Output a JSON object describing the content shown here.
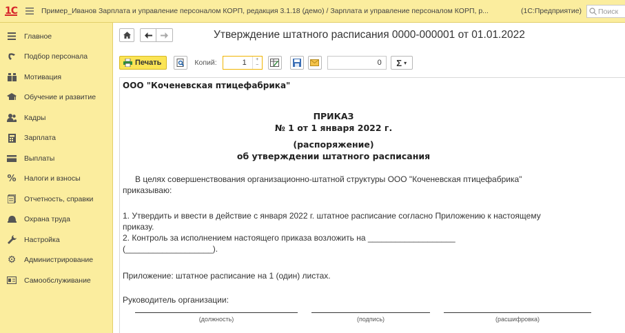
{
  "titlebar": {
    "logo": "1С",
    "title": "Пример_Иванов Зарплата и управление персоналом КОРП, редакция 3.1.18 (демо) / Зарплата и управление персоналом КОРП, р...",
    "app": "(1С:Предприятие)",
    "search_placeholder": "Поиск"
  },
  "sidebar": {
    "items": [
      {
        "label": "Главное",
        "icon": "menu-lines-icon"
      },
      {
        "label": "Подбор персонала",
        "icon": "recruit-icon"
      },
      {
        "label": "Мотивация",
        "icon": "people-icon"
      },
      {
        "label": "Обучение и развитие",
        "icon": "graduation-cap-icon"
      },
      {
        "label": "Кадры",
        "icon": "staff-icon"
      },
      {
        "label": "Зарплата",
        "icon": "calculator-icon"
      },
      {
        "label": "Выплаты",
        "icon": "payment-icon"
      },
      {
        "label": "Налоги и взносы",
        "icon": "percent-icon"
      },
      {
        "label": "Отчетность, справки",
        "icon": "report-icon"
      },
      {
        "label": "Охрана труда",
        "icon": "helmet-icon"
      },
      {
        "label": "Настройка",
        "icon": "wrench-icon"
      },
      {
        "label": "Администрирование",
        "icon": "gear-icon"
      },
      {
        "label": "Самообслуживание",
        "icon": "id-card-icon"
      }
    ]
  },
  "document": {
    "title": "Утверждение штатного расписания 0000-000001 от 01.01.2022"
  },
  "toolbar": {
    "print_label": "Печать",
    "copies_label": "Копий:",
    "copies_value": "1",
    "sum_value": "0",
    "sigma_label": "Σ"
  },
  "order": {
    "org": "ООО \"Коченевская птицефабрика\"",
    "heading": "ПРИКАЗ",
    "number": "№ 1 от 1 января 2022 г.",
    "subheading": "(распоряжение)",
    "about": "об утверждении штатного расписания",
    "intro_1": "В целях совершенствования организационно-штатной структуры ООО \"Коченевская птицефабрика\"",
    "intro_2": "приказываю:",
    "item1_1": "1. Утвердить и ввести в действие с января 2022 г. штатное расписание согласно Приложению к настоящему",
    "item1_2": "приказу.",
    "item2_1": "2. Контроль за исполнением настоящего приказа возложить на ___________________",
    "item2_2": "(___________________).",
    "appendix": "Приложение: штатное расписание на 1 (один) листах.",
    "head_label": "Руководитель организации:",
    "sig_position": "(должность)",
    "sig_signature": "(подпись)",
    "sig_decoding": "(расшифровка)"
  },
  "colors": {
    "accent": "#fbed9e",
    "print_button": "#fbe455",
    "logo": "#d6252a"
  }
}
